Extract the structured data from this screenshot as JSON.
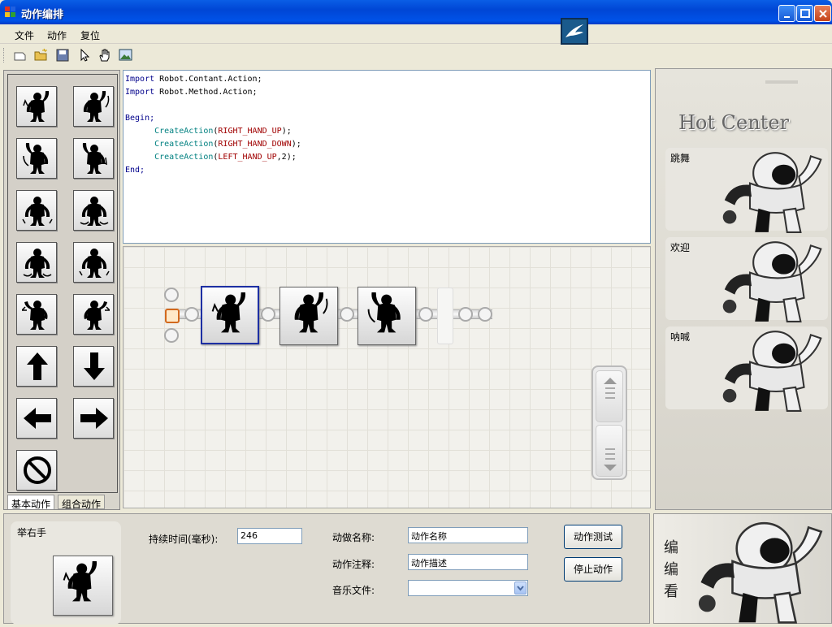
{
  "window": {
    "title": "动作编排"
  },
  "menu": [
    {
      "label": "文件"
    },
    {
      "label": "动作"
    },
    {
      "label": "复位"
    }
  ],
  "toolbar": {
    "icons": [
      "new-file-icon",
      "open-folder-icon",
      "save-icon",
      "pointer-icon",
      "hand-icon",
      "image-icon"
    ]
  },
  "palette": {
    "tabs": [
      {
        "label": "基本动作"
      },
      {
        "label": "组合动作"
      }
    ]
  },
  "code": {
    "line1_kw": "Import",
    "line1_rest": " Robot.Contant.Action;",
    "line2_kw": "Import",
    "line2_rest": " Robot.Method.Action;",
    "begin": "Begin;",
    "fn": "CreateAction",
    "arg1": "RIGHT_HAND_UP",
    "arg2": "RIGHT_HAND_DOWN",
    "arg3": "LEFT_HAND_UP",
    "arg3_extra": ",2",
    "end": "End;"
  },
  "hot": {
    "title": "Hot Center",
    "items": [
      {
        "label": "跳舞"
      },
      {
        "label": "欢迎"
      },
      {
        "label": "呐喊"
      }
    ]
  },
  "detail": {
    "selected_name": "举右手",
    "duration_label": "持续时间(毫秒):",
    "duration_value": "246",
    "name_label": "动做名称:",
    "name_value": "动作名称",
    "note_label": "动作注释:",
    "note_value": "动作描述",
    "music_label": "音乐文件:",
    "music_value": "",
    "test_button": "动作测试",
    "stop_button": "停止动作"
  },
  "promo": {
    "text": "编编看"
  },
  "colors": {
    "title_bar": "#0054e3",
    "selection": "#1d2fa3",
    "start_node": "#d2691e"
  }
}
